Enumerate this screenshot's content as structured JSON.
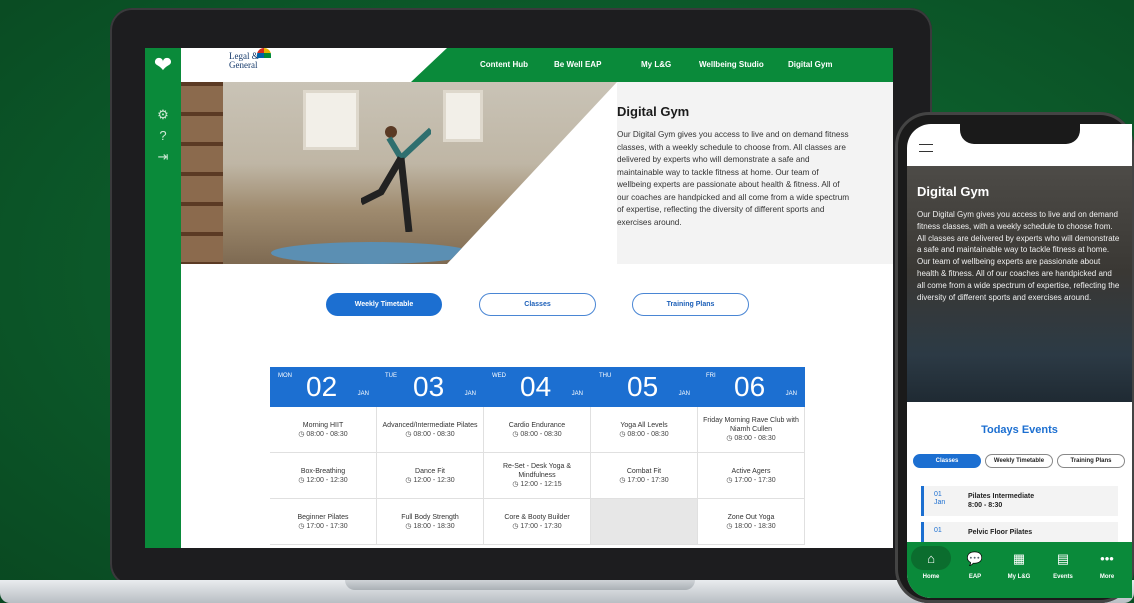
{
  "sidebar": {
    "icons": [
      "heart-logo-icon",
      "gear-icon",
      "help-icon",
      "logout-icon"
    ]
  },
  "header": {
    "brand_line1": "Legal &",
    "brand_line2": "General",
    "nav": [
      "Content Hub",
      "Be Well EAP",
      "My L&G",
      "Wellbeing Studio",
      "Digital Gym"
    ]
  },
  "hero": {
    "title": "Digital Gym",
    "body": "Our Digital Gym gives you access to live and on demand fitness classes, with a weekly schedule to choose from. All classes are delivered by experts who will demonstrate a safe and maintainable way to tackle fitness at home. Our team of wellbeing experts are passionate about health & fitness. All of our coaches are handpicked and all come from a wide spectrum of expertise, reflecting the diversity of different sports and exercises around."
  },
  "tabs": [
    {
      "label": "Weekly Timetable",
      "active": true
    },
    {
      "label": "Classes",
      "active": false
    },
    {
      "label": "Training Plans",
      "active": false
    }
  ],
  "timetable": {
    "days": [
      {
        "dow": "MON",
        "date": "02",
        "month": "JAN"
      },
      {
        "dow": "TUE",
        "date": "03",
        "month": "JAN"
      },
      {
        "dow": "WED",
        "date": "04",
        "month": "JAN"
      },
      {
        "dow": "THU",
        "date": "05",
        "month": "JAN"
      },
      {
        "dow": "FRI",
        "date": "06",
        "month": "JAN"
      }
    ],
    "rows": [
      [
        {
          "name": "Morning HIIT",
          "time": "08:00 - 08:30"
        },
        {
          "name": "Advanced/Intermediate Pilates",
          "time": "08:00 - 08:30"
        },
        {
          "name": "Cardio Endurance",
          "time": "08:00 - 08:30"
        },
        {
          "name": "Yoga All Levels",
          "time": "08:00 - 08:30"
        },
        {
          "name": "Friday Morning Rave Club with Niamh Cullen",
          "time": "08:00 - 08:30"
        }
      ],
      [
        {
          "name": "Box-Breathing",
          "time": "12:00 - 12:30"
        },
        {
          "name": "Dance Fit",
          "time": "12:00 - 12:30"
        },
        {
          "name": "Re-Set - Desk Yoga & Mindfulness",
          "time": "12:00 - 12:15"
        },
        {
          "name": "Combat Fit",
          "time": "17:00 - 17:30"
        },
        {
          "name": "Active Agers",
          "time": "17:00 - 17:30"
        }
      ],
      [
        {
          "name": "Beginner Pilates",
          "time": "17:00 - 17:30"
        },
        {
          "name": "Full Body Strength",
          "time": "18:00 - 18:30"
        },
        {
          "name": "Core & Booty Builder",
          "time": "17:00 - 17:30"
        },
        {
          "name": "",
          "time": ""
        },
        {
          "name": "Zone Out Yoga",
          "time": "18:00 - 18:30"
        }
      ]
    ]
  },
  "phone": {
    "title": "Digital Gym",
    "body": "Our Digital Gym gives you access to live and on demand fitness classes, with a weekly schedule to choose from. All classes are delivered by experts who will demonstrate a safe and maintainable way to tackle fitness at home. Our team of wellbeing experts are passionate about health & fitness. All of our coaches are handpicked and all come from a wide spectrum of expertise, reflecting the diversity of different sports and exercises around.",
    "events_title": "Todays Events",
    "tabs": [
      {
        "label": "Classes",
        "active": true
      },
      {
        "label": "Weekly Timetable",
        "active": false
      },
      {
        "label": "Training Plans",
        "active": false
      }
    ],
    "events": [
      {
        "day": "01",
        "month": "Jan",
        "name": "Pilates Intermediate",
        "time": "8:00 - 8:30"
      },
      {
        "day": "01",
        "month": "",
        "name": "Pelvic Floor Pilates",
        "time": ""
      }
    ],
    "bottom_nav": [
      {
        "label": "Home",
        "icon": "home-icon"
      },
      {
        "label": "EAP",
        "icon": "chat-icon"
      },
      {
        "label": "My L&G",
        "icon": "building-icon"
      },
      {
        "label": "Events",
        "icon": "calendar-icon"
      },
      {
        "label": "More",
        "icon": "more-icon"
      }
    ]
  },
  "colors": {
    "brand_green": "#0a8a3a",
    "accent_blue": "#1c6fd1",
    "background": "#0c5a2a"
  }
}
